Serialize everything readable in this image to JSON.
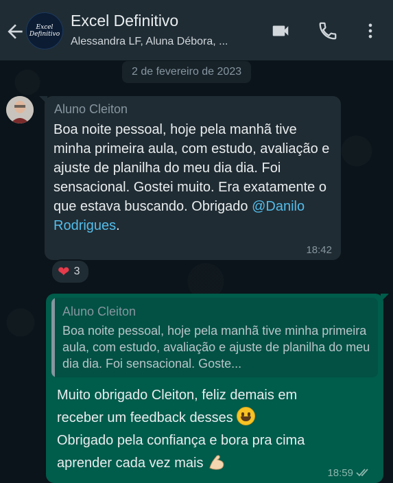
{
  "header": {
    "group_name": "Excel Definitivo",
    "participants": "Alessandra LF, Aluna Débora, ...",
    "avatar_text_line1": "Excel",
    "avatar_text_line2": "Definitivo",
    "icons": [
      "back-arrow-icon",
      "video-call-icon",
      "phone-icon",
      "more-options-icon"
    ]
  },
  "date_separator": "2 de fevereiro de 2023",
  "messages": [
    {
      "direction": "incoming",
      "sender": "Aluno Cleiton",
      "text": "Boa noite pessoal, hoje pela manhã tive minha primeira aula, com estudo, avaliação e ajuste de planilha do meu dia dia. Foi sensacional. Gostei muito. Era exatamente o que estava buscando. Obrigado ",
      "mention": "@Danilo Rodrigues",
      "text_end": ".",
      "time": "18:42",
      "reaction": {
        "emoji": "❤",
        "count": "3"
      }
    },
    {
      "direction": "outgoing",
      "quoted_sender": "Aluno Cleiton",
      "quoted_text": "Boa noite pessoal, hoje pela manhã tive minha primeira aula, com estudo, avaliação e ajuste de planilha do meu dia dia. Foi sensacional. Goste...",
      "line1": "Muito obrigado Cleiton, feliz demais em",
      "line2": "receber um feedback desses",
      "line3": "Obrigado pela confiança e  bora pra cima",
      "line4": "aprender cada vez mais",
      "time": "18:59",
      "status": "read"
    }
  ],
  "colors": {
    "header_bg": "#1f2c34",
    "chat_bg": "#0b141a",
    "incoming_bubble": "#202c33",
    "outgoing_bubble": "#005c4b",
    "mention": "#53bdeb"
  }
}
